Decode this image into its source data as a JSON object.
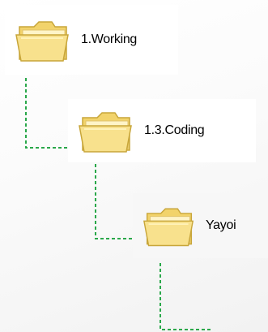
{
  "tree": {
    "nodes": [
      {
        "label": "1.Working",
        "icon": "folder-icon"
      },
      {
        "label": "1.3.Coding",
        "icon": "folder-icon"
      },
      {
        "label": "Yayoi",
        "icon": "folder-icon"
      }
    ]
  },
  "colors": {
    "connector": "#2aa84a",
    "folder_body": "#f2d36b",
    "folder_front": "#f8e18d",
    "folder_outline": "#c8a63a"
  }
}
